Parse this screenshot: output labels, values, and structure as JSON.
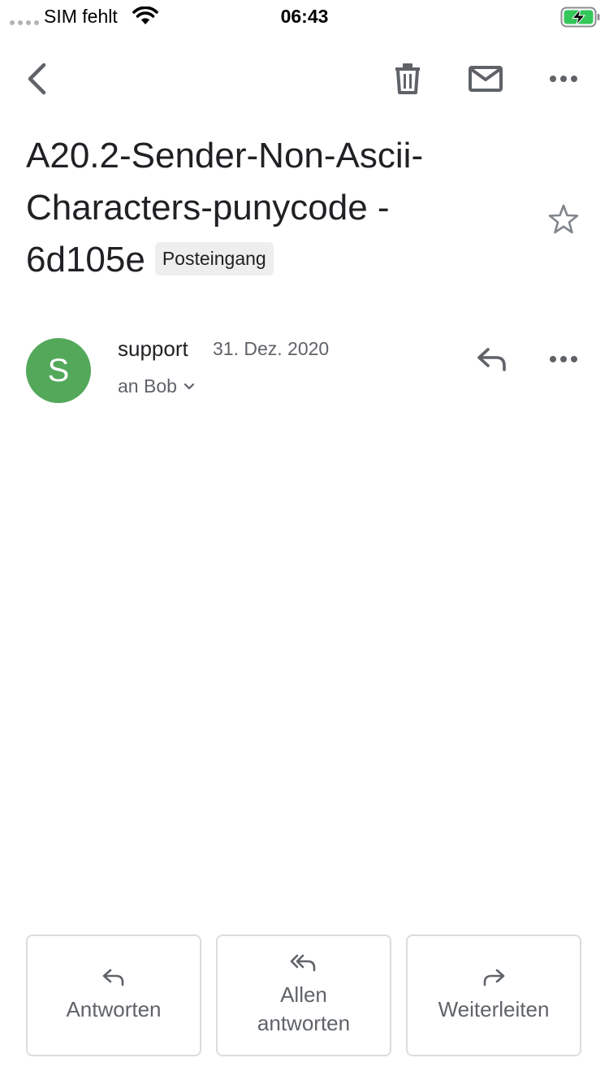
{
  "status_bar": {
    "carrier": "SIM fehlt",
    "time": "06:43"
  },
  "email": {
    "subject": "A20.2-Sender-Non-Ascii-Characters-punycode - 6d105e",
    "label": "Posteingang",
    "sender_initial": "S",
    "sender": "support",
    "date": "31. Dez. 2020",
    "recipient": "an Bob"
  },
  "actions": {
    "reply": "Antworten",
    "reply_all": "Allen\nantworten",
    "forward": "Weiterleiten"
  },
  "colors": {
    "avatar": "#53a85a",
    "battery_charging": "#34c759"
  }
}
